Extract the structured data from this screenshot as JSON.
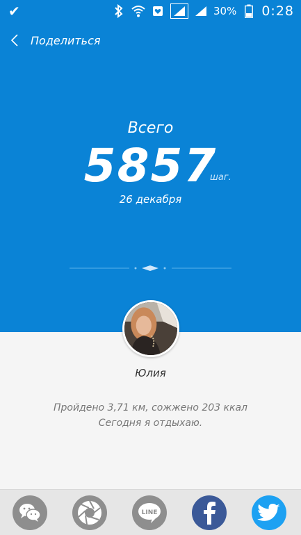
{
  "statusbar": {
    "battery": "30%",
    "time": "0:28",
    "icons": [
      "check-icon",
      "bluetooth-icon",
      "wifi-icon",
      "notification-icon",
      "signal-icon",
      "signal-icon",
      "battery-icon"
    ]
  },
  "header": {
    "title": "Поделиться",
    "back_icon": "chevron-left-icon"
  },
  "summary": {
    "label": "Всего",
    "steps": "5857",
    "unit": "шаг.",
    "date": "26 декабря"
  },
  "profile": {
    "name": "Юлия"
  },
  "stats": {
    "line1": "Пройдено 3,71 км, сожжено 203 ккал",
    "line2": "Сегодня я отдыхаю."
  },
  "share": {
    "items": [
      {
        "name": "wechat",
        "icon": "wechat-icon",
        "color": "#8e8e8e"
      },
      {
        "name": "moments",
        "icon": "aperture-icon",
        "color": "#8e8e8e"
      },
      {
        "name": "line",
        "icon": "line-icon",
        "color": "#8e8e8e"
      },
      {
        "name": "facebook",
        "icon": "facebook-icon",
        "color": "#3b5998"
      },
      {
        "name": "twitter",
        "icon": "twitter-icon",
        "color": "#1da1f2"
      }
    ]
  },
  "colors": {
    "primary": "#0a83d6",
    "background": "#f5f5f5"
  }
}
